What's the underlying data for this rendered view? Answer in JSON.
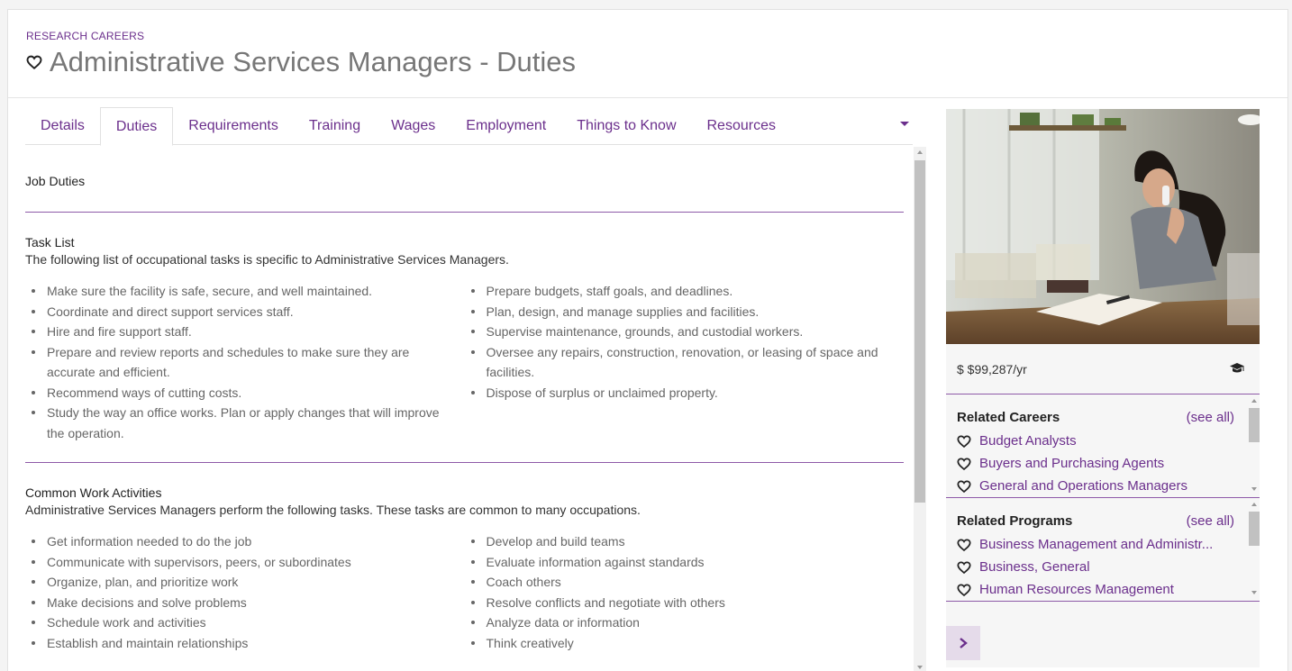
{
  "header": {
    "eyebrow": "RESEARCH CAREERS",
    "title": "Administrative Services Managers - Duties"
  },
  "tabs": [
    {
      "label": "Details"
    },
    {
      "label": "Duties",
      "active": true
    },
    {
      "label": "Requirements"
    },
    {
      "label": "Training"
    },
    {
      "label": "Wages"
    },
    {
      "label": "Employment"
    },
    {
      "label": "Things to Know"
    },
    {
      "label": "Resources"
    }
  ],
  "main": {
    "section_title": "Job Duties",
    "task_list": {
      "title": "Task List",
      "description": "The following list of occupational tasks is specific to Administrative Services Managers.",
      "left": [
        "Make sure the facility is safe, secure, and well maintained.",
        "Coordinate and direct support services staff.",
        "Hire and fire support staff.",
        "Prepare and review reports and schedules to make sure they are accurate and efficient.",
        "Recommend ways of cutting costs.",
        "Study the way an office works. Plan or apply changes that will improve the operation."
      ],
      "right": [
        "Prepare budgets, staff goals, and deadlines.",
        "Plan, design, and manage supplies and facilities.",
        "Supervise maintenance, grounds, and custodial workers.",
        "Oversee any repairs, construction, renovation, or leasing of space and facilities.",
        "Dispose of surplus or unclaimed property."
      ]
    },
    "work_activities": {
      "title": "Common Work Activities",
      "description": "Administrative Services Managers perform the following tasks. These tasks are common to many occupations.",
      "left": [
        "Get information needed to do the job",
        "Communicate with supervisors, peers, or subordinates",
        "Organize, plan, and prioritize work",
        "Make decisions and solve problems",
        "Schedule work and activities",
        "Establish and maintain relationships"
      ],
      "right": [
        "Develop and build teams",
        "Evaluate information against standards",
        "Coach others",
        "Resolve conflicts and negotiate with others",
        "Analyze data or information",
        "Think creatively"
      ]
    }
  },
  "sidebar": {
    "wage": "$ $99,287/yr",
    "related_careers": {
      "title": "Related Careers",
      "see_all": "(see all)",
      "items": [
        "Budget Analysts",
        "Buyers and Purchasing Agents",
        "General and Operations Managers"
      ]
    },
    "related_programs": {
      "title": "Related Programs",
      "see_all": "(see all)",
      "items": [
        "Business Management and Administr...",
        "Business, General",
        "Human Resources Management"
      ]
    }
  },
  "icons": {
    "favorite": "heart-outline-icon",
    "education": "graduation-cap-icon",
    "next": "chevron-right-icon"
  },
  "colors": {
    "accent": "#6b2f8c",
    "divider": "#8e5aa8"
  }
}
